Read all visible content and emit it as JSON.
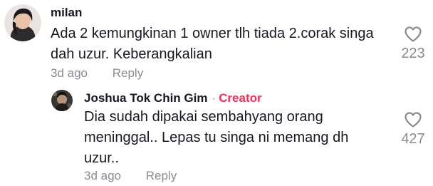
{
  "comments": [
    {
      "username": "milan",
      "text": "Ada 2 kemungkinan 1 owner tlh tiada 2.corak singa\ndah uzur. Keberangkalian",
      "time": "3d ago",
      "reply_label": "Reply",
      "likes": "223",
      "avatar_icon": "user-avatar-photo",
      "like_icon": "heart-outline-icon"
    },
    {
      "username": "Joshua Tok Chin Gim",
      "separator": "·",
      "badge": "Creator",
      "text": "Dia sudah dipakai sembahyang orang\nmeninggal.. Lepas tu singa ni memang dh\nuzur..",
      "time": "3d ago",
      "reply_label": "Reply",
      "likes": "427",
      "avatar_icon": "user-avatar-photo",
      "like_icon": "heart-outline-icon"
    }
  ],
  "colors": {
    "text": "#161823",
    "muted": "#8a8b91",
    "creator": "#fe2c55"
  }
}
